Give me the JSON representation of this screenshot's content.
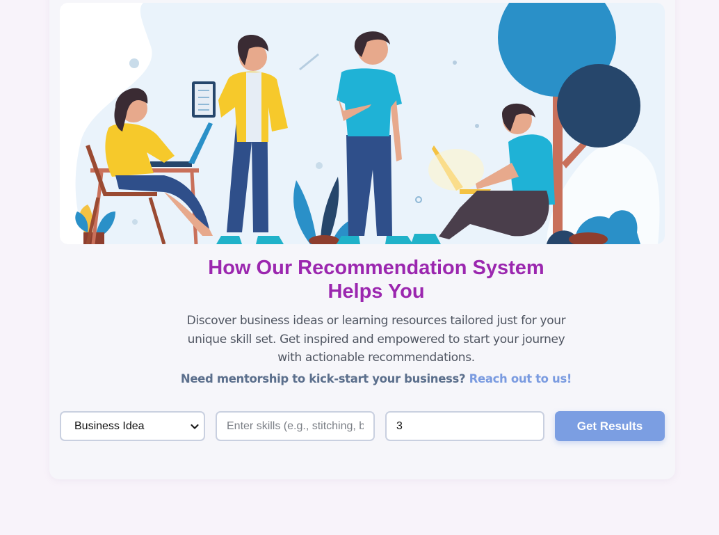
{
  "section": {
    "headline": "How Our Recommendation System Helps You",
    "description": "Discover business ideas or learning resources tailored just for your unique skill set. Get inspired and empowered to start your journey with actionable recommendations.",
    "mentorship_text": "Need mentorship to kick-start your business?",
    "mentorship_link": "Reach out to us!"
  },
  "form": {
    "type_selected": "Business Idea",
    "skills_placeholder": "Enter skills (e.g., stitching, baking)",
    "count_value": "3",
    "submit_label": "Get Results"
  },
  "icons": {
    "dropdown": "chevron-down-icon"
  },
  "colors": {
    "headline": "#9b27af",
    "link": "#7a9be0",
    "button": "#7b9ee2",
    "page_background": "#f8f3fa",
    "card_background": "#f6f6fa"
  }
}
